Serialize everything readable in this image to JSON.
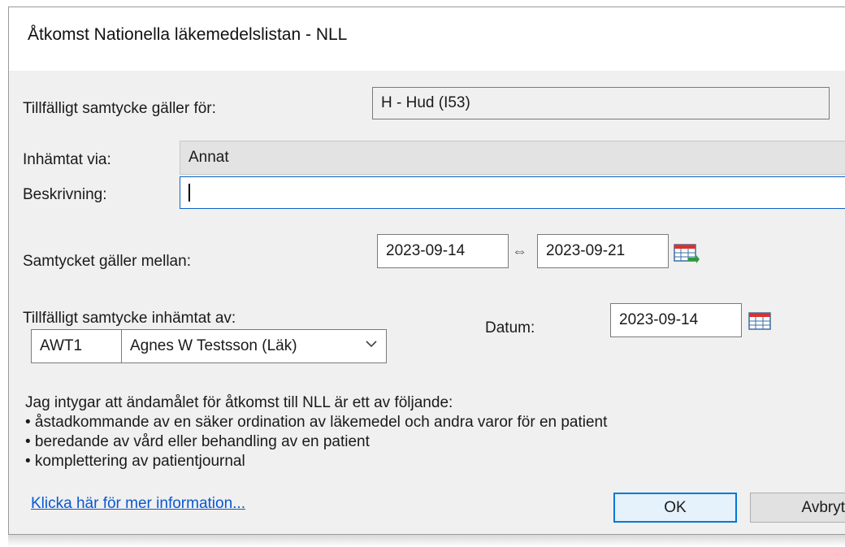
{
  "dialog": {
    "title": "Åtkomst Nationella läkemedelslistan - NLL"
  },
  "consent_for": {
    "label": "Tillfälligt samtycke gäller för:",
    "value": "H - Hud (I53)"
  },
  "obtained_via": {
    "label": "Inhämtat via:",
    "value": "Annat"
  },
  "description": {
    "label": "Beskrivning:",
    "value": ""
  },
  "valid_between": {
    "label": "Samtycket gäller mellan:",
    "from": "2023-09-14",
    "separator": "⇔",
    "to": "2023-09-21"
  },
  "obtained_by": {
    "label": "Tillfälligt samtycke inhämtat av:",
    "code": "AWT1",
    "name": "Agnes W Testsson (Läk)"
  },
  "date": {
    "label": "Datum:",
    "value": "2023-09-14"
  },
  "attestation": {
    "intro": "Jag intygar att ändamålet för åtkomst till NLL är ett av följande:",
    "items": [
      "• åstadkommande av en säker ordination av läkemedel och andra varor för en patient",
      "• beredande av vård eller behandling av en patient",
      "• komplettering av patientjournal"
    ]
  },
  "more_info_link": "Klicka här för mer information...",
  "buttons": {
    "ok": "OK",
    "cancel": "Avbryt"
  },
  "icons": {
    "calendar": "calendar-icon",
    "dropdown": "chevron-down-icon"
  },
  "colors": {
    "link": "#0a58d0",
    "focus_border": "#0a64c8",
    "default_button_border": "#0078d7",
    "calendar_red": "#d9342b"
  }
}
